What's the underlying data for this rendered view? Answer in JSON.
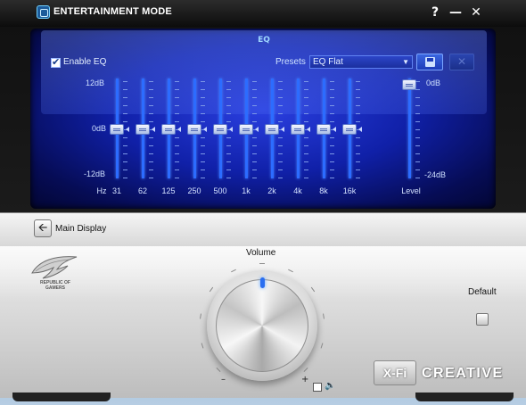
{
  "window": {
    "title": "ENTERTAINMENT MODE",
    "help_label": "?",
    "minimize_label": "—",
    "close_label": "✕"
  },
  "eq": {
    "header": "EQ",
    "enable_label": "Enable EQ",
    "enabled": true,
    "presets_label": "Presets",
    "preset_value": "EQ Flat",
    "db_top": "12dB",
    "db_mid": "0dB",
    "db_bottom": "-12dB",
    "hz_label": "Hz",
    "bands": [
      {
        "label": "31",
        "gain_db": 0
      },
      {
        "label": "62",
        "gain_db": 0
      },
      {
        "label": "125",
        "gain_db": 0
      },
      {
        "label": "250",
        "gain_db": 0
      },
      {
        "label": "500",
        "gain_db": 0
      },
      {
        "label": "1k",
        "gain_db": 0
      },
      {
        "label": "2k",
        "gain_db": 0
      },
      {
        "label": "4k",
        "gain_db": 0
      },
      {
        "label": "8k",
        "gain_db": 0
      },
      {
        "label": "16k",
        "gain_db": 0
      }
    ],
    "level_label": "Level",
    "level_top": "0dB",
    "level_bottom": "-24dB",
    "level_db": 0
  },
  "main_display": {
    "label": "Main Display"
  },
  "body": {
    "rog_line1": "REPUBLIC OF",
    "rog_line2": "GAMERS",
    "volume_label": "Volume",
    "volume_min_label": "–",
    "volume_max_label": "+",
    "mute_checked": false,
    "default_label": "Default",
    "xfi_label": "X-Fi",
    "brand_label": "CREATIVE"
  },
  "colors": {
    "screen_glow": "#2a3fe0",
    "slider_accent": "#2c6cff",
    "knob_indicator": "#2a6ef0"
  },
  "icons": {
    "app": "app-icon",
    "back": "arrow-left-icon",
    "save": "floppy-disk-icon",
    "delete": "close-x-icon",
    "speaker": "speaker-icon"
  }
}
